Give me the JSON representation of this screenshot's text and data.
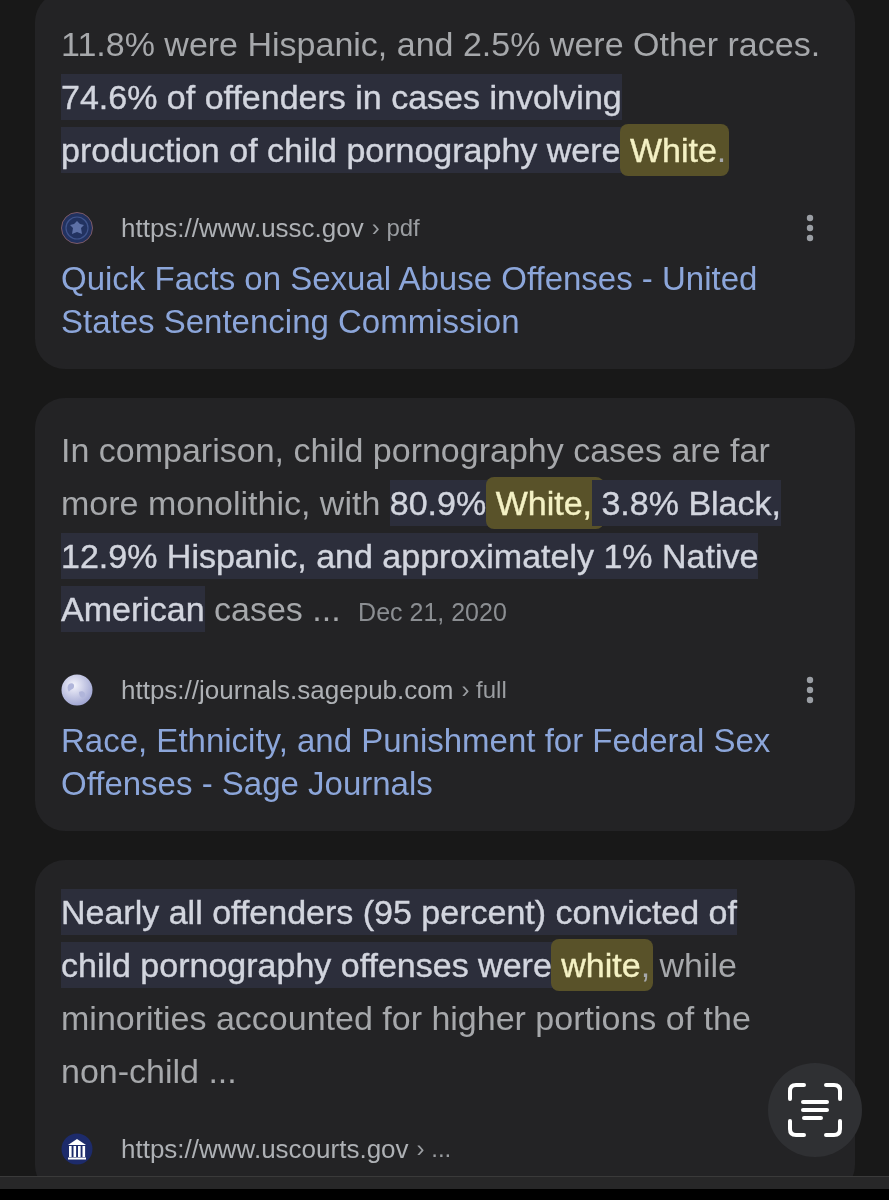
{
  "results": [
    {
      "snippet_lines": [
        [
          {
            "kind": "plain",
            "text": "11.8% were Hispanic, and 2.5% were Other races."
          }
        ],
        [
          {
            "kind": "highlight",
            "text": "74.6% of offenders in cases involving"
          }
        ],
        [
          {
            "kind": "highlight",
            "text": "production of child pornography were "
          },
          {
            "kind": "match",
            "text": "White"
          },
          {
            "kind": "plain",
            "text": "."
          }
        ]
      ],
      "url": "https://www.ussc.gov",
      "path": "› pdf",
      "more_options": true,
      "title": "Quick Facts on Sexual Abuse Offenses - United States Sentencing Commission"
    },
    {
      "snippet_lines": [
        [
          {
            "kind": "plain",
            "text": "In comparison, child pornography cases are far"
          }
        ],
        [
          {
            "kind": "plain",
            "text": "more monolithic, with "
          },
          {
            "kind": "highlight",
            "text": "80.9% "
          },
          {
            "kind": "match",
            "text": "White,"
          },
          {
            "kind": "highlight",
            "text": " 3.8% Black,"
          }
        ],
        [
          {
            "kind": "highlight",
            "text": "12.9% Hispanic, and approximately 1% Native"
          }
        ],
        [
          {
            "kind": "highlight",
            "text": "American"
          },
          {
            "kind": "plain",
            "text": " cases ... "
          },
          {
            "kind": "date",
            "text": "Dec 21, 2020"
          }
        ]
      ],
      "url": "https://journals.sagepub.com",
      "path": "› full",
      "more_options": true,
      "title": "Race, Ethnicity, and Punishment for Federal Sex Offenses - Sage Journals"
    },
    {
      "snippet_lines": [
        [
          {
            "kind": "highlight",
            "text": "Nearly all offenders (95 percent) convicted of"
          }
        ],
        [
          {
            "kind": "highlight",
            "text": "child pornography offenses were "
          },
          {
            "kind": "match",
            "text": "white"
          },
          {
            "kind": "plain",
            "text": ", while"
          }
        ],
        [
          {
            "kind": "plain",
            "text": "minorities accounted for higher portions of the"
          }
        ],
        [
          {
            "kind": "plain",
            "text": "non-child ..."
          }
        ]
      ],
      "url": "https://www.uscourts.gov",
      "path": "› ...",
      "more_options": false
    }
  ]
}
